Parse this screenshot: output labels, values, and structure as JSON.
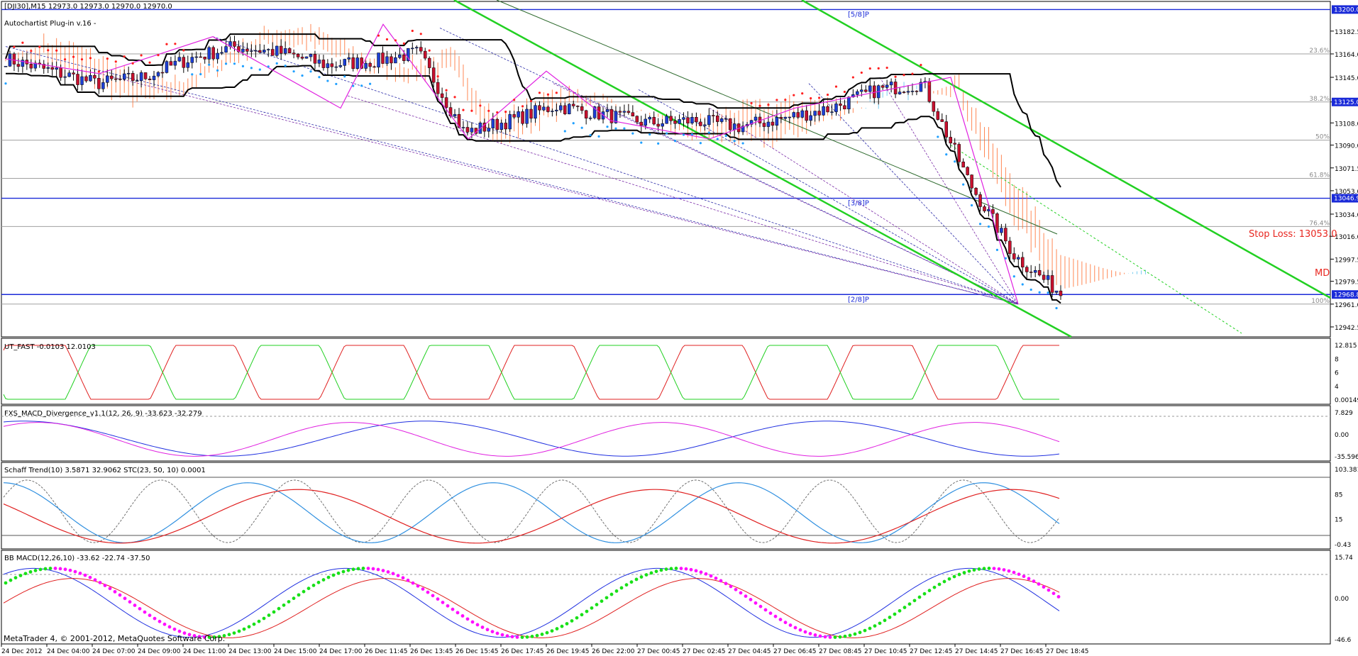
{
  "main": {
    "symbol_line": "[DJI30],M15  12973.0 12973.0 12970.0 12970.0",
    "plugin_label": "Autochartist Plug-in v.16 -",
    "stop_loss": "Stop Loss: 13053.0",
    "md_label": "MD",
    "murray": [
      {
        "label": "[5/8]P",
        "price": 13200
      },
      {
        "label": "[3/8]P",
        "price": 13046.9
      },
      {
        "label": "[2/8]P",
        "price": 12968.8
      }
    ],
    "fib_levels": [
      {
        "label": "23.6%",
        "price": 13164
      },
      {
        "label": "38.2%",
        "price": 13125
      },
      {
        "label": "50%",
        "price": 13094
      },
      {
        "label": "61.8%",
        "price": 13063
      },
      {
        "label": "76.4%",
        "price": 13024
      },
      {
        "label": "100%",
        "price": 12961
      }
    ],
    "price_ticks": [
      "13182.5",
      "13164.0",
      "13145.0",
      "13125.0",
      "13108.0",
      "13090.0",
      "13071.5",
      "13053.0",
      "13034.0",
      "13016.0",
      "12997.5",
      "12979.5",
      "12961.0",
      "12942.5"
    ],
    "tick_values": [
      13182.5,
      13164.0,
      13145.0,
      13125.0,
      13108.0,
      13090.0,
      13071.5,
      13053.0,
      13034.0,
      13016.0,
      12997.5,
      12979.5,
      12961.0,
      12942.5
    ],
    "marked_prices": [
      {
        "label": "13200.0",
        "price": 13200,
        "color": "#1a2ad8"
      },
      {
        "label": "13125.0",
        "price": 13125,
        "color": "#1a2ad8"
      },
      {
        "label": "13046.9",
        "price": 13046.9,
        "color": "#1a2ad8"
      },
      {
        "label": "12968.8",
        "price": 12968.8,
        "color": "#1a2ad8"
      }
    ],
    "price_range": [
      12935,
      13206
    ]
  },
  "ut_fast": {
    "label": "UT_FAST -0.0103 12.0103",
    "ticks": [
      "12.815",
      "8",
      "6",
      "4",
      "0.00149"
    ]
  },
  "macd_div": {
    "label": "FXS_MACD_Divergence_v1.1(12, 26, 9) -33.623 -32.279",
    "ticks": [
      "7.829",
      "0.00",
      "-35.596"
    ]
  },
  "schaff": {
    "label": "Schaff Trend(10) 3.5871 32.9062  STC(23, 50, 10) 0.0001",
    "ticks": [
      "103.381",
      "85",
      "15",
      "-0.43"
    ]
  },
  "bb_macd": {
    "label": "BB MACD(12,26,10) -33.62 -22.74 -37.50",
    "ticks": [
      "15.74",
      "0.00",
      "-46.6"
    ]
  },
  "footer": "MetaTrader 4, © 2001-2012, MetaQuotes Software Corp.",
  "time_axis": [
    "24 Dec 2012",
    "24 Dec 04:00",
    "24 Dec 07:00",
    "24 Dec 09:00",
    "24 Dec 11:00",
    "24 Dec 13:00",
    "24 Dec 15:00",
    "24 Dec 17:00",
    "26 Dec 11:45",
    "26 Dec 13:45",
    "26 Dec 15:45",
    "26 Dec 17:45",
    "26 Dec 19:45",
    "26 Dec 22:00",
    "27 Dec 00:45",
    "27 Dec 02:45",
    "27 Dec 04:45",
    "27 Dec 06:45",
    "27 Dec 08:45",
    "27 Dec 10:45",
    "27 Dec 12:45",
    "27 Dec 14:45",
    "27 Dec 16:45",
    "27 Dec 18:45"
  ],
  "colors": {
    "bull": "#1d3fd6",
    "bear": "#c8102e",
    "green_channel": "#22d022",
    "cloud_orange": "#ff6a2a",
    "cloud_blue": "#55c0ee",
    "grid": "#c0c0c0"
  },
  "chart_data": {
    "type": "line",
    "title": "[DJI30],M15  12973.0 12973.0 12970.0 12970.0",
    "xlabel": "",
    "ylabel": "",
    "ylim": [
      12935,
      13206
    ],
    "x": [
      "24 Dec 2012",
      "24 Dec 04:00",
      "24 Dec 07:00",
      "24 Dec 09:00",
      "24 Dec 11:00",
      "24 Dec 13:00",
      "24 Dec 15:00",
      "24 Dec 17:00",
      "26 Dec 11:45",
      "26 Dec 13:45",
      "26 Dec 15:45",
      "26 Dec 17:45",
      "26 Dec 19:45",
      "26 Dec 22:00",
      "27 Dec 00:45",
      "27 Dec 02:45",
      "27 Dec 04:45",
      "27 Dec 06:45",
      "27 Dec 08:45",
      "27 Dec 10:45",
      "27 Dec 12:45",
      "27 Dec 14:45",
      "27 Dec 16:45",
      "27 Dec 18:45"
    ],
    "series": [
      {
        "values": [
          13160,
          13150,
          13140,
          13145,
          13160,
          13170,
          13165,
          13155,
          13158,
          13165,
          13100,
          13110,
          13122,
          13115,
          13108,
          13110,
          13105,
          13112,
          13120,
          13135,
          13140,
          13060,
          13000,
          12970
        ]
      }
    ]
  }
}
